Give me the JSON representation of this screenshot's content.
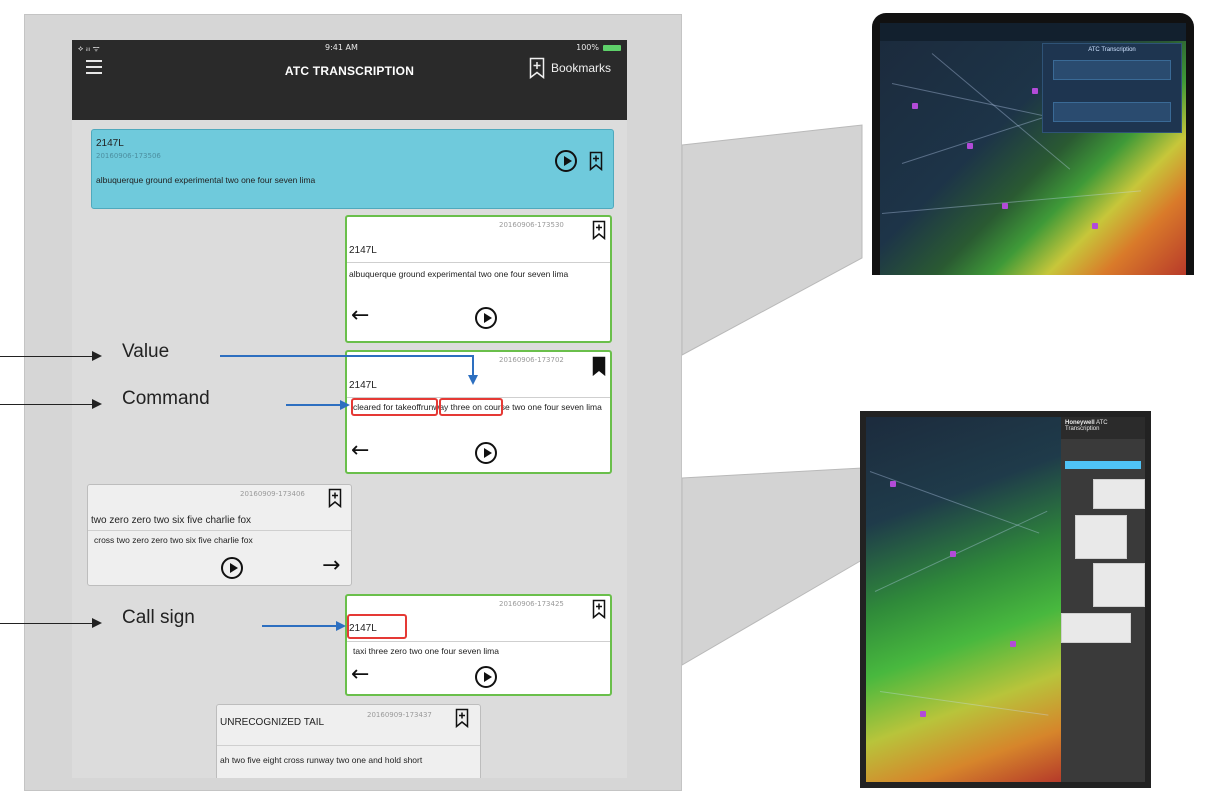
{
  "app": {
    "status_left": "⟡ ᵢₗₗ ᯤ",
    "status_time": "9:41 AM",
    "status_battery": "100%",
    "title": "ATC TRANSCRIPTION",
    "bookmarks_label": "Bookmarks"
  },
  "messages": [
    {
      "tail": "2147L",
      "timestamp": "20160906-173506",
      "text": "albuquerque ground experimental two one four seven lima"
    },
    {
      "tail": "2147L",
      "timestamp": "20160906-173530",
      "text": "albuquerque ground experimental two one four seven lima"
    },
    {
      "tail": "2147L",
      "timestamp": "20160906-173702",
      "text_command": "cleared for takeoff",
      "text_value": "runway three",
      "text_rest": " on course two one four seven lima"
    },
    {
      "tail": "two zero zero two six five charlie fox",
      "timestamp": "20160909-173406",
      "text": "cross two zero zero two six five charlie fox"
    },
    {
      "tail": "2147L",
      "timestamp": "20160906-173425",
      "text": "taxi three zero two one four seven lima"
    },
    {
      "tail": "UNRECOGNIZED TAIL",
      "timestamp": "20160909-173437",
      "text": "ah two five eight cross runway two one and hold short"
    }
  ],
  "annotations": {
    "value": "Value",
    "command": "Command",
    "call_sign": "Call sign"
  },
  "thumbnails": {
    "top_panel_title": "ATC Transcription",
    "bottom_brand": "Honeywell",
    "bottom_panel_title": "ATC Transcription"
  },
  "colors": {
    "highlight_card": "#6fcadc",
    "own_message_border": "#6abf4b",
    "annotation_box": "#e53935",
    "annotation_arrow": "#2d6fc0"
  }
}
